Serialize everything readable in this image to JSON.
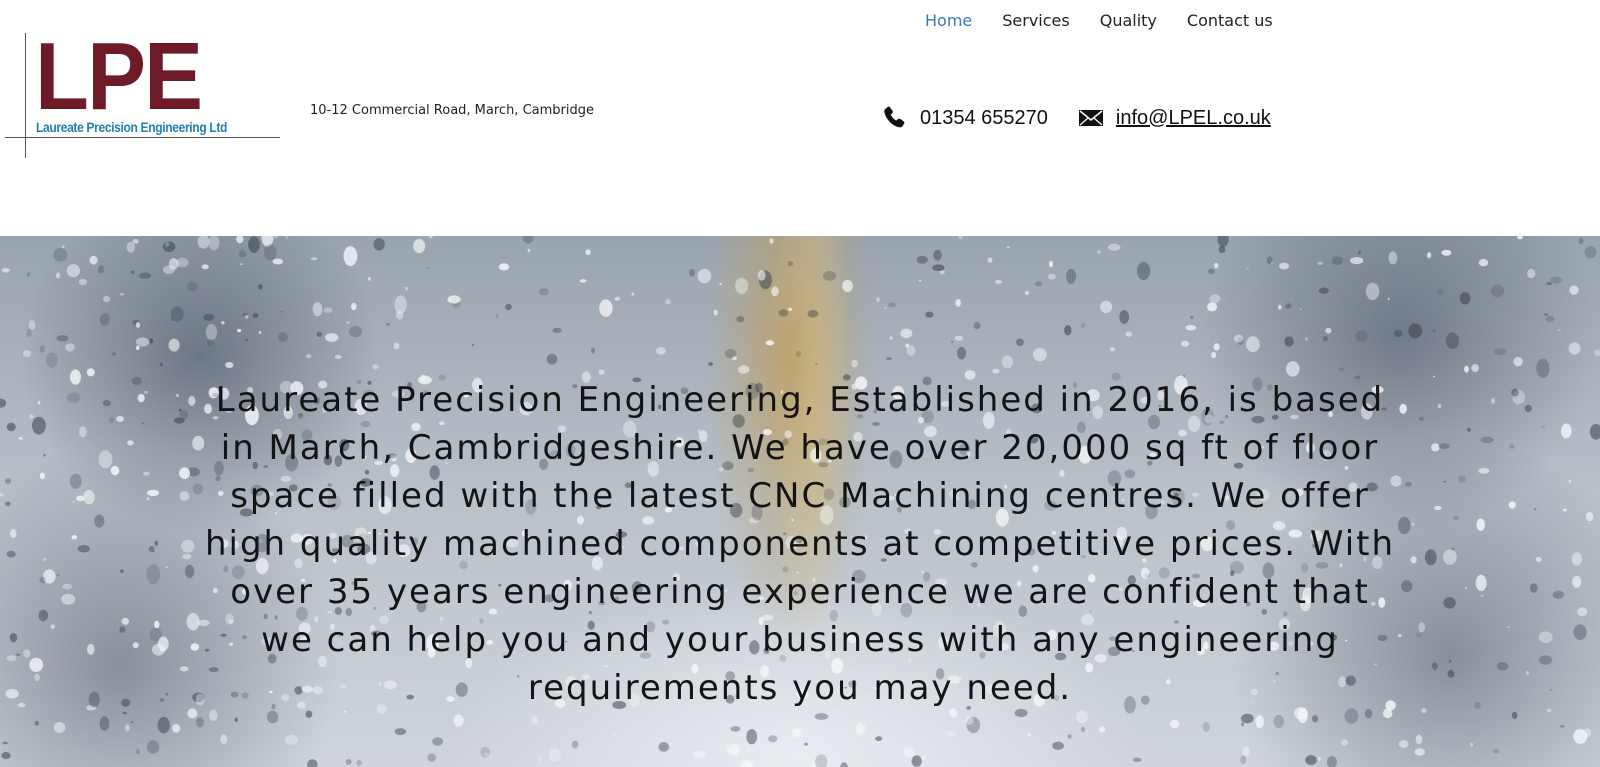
{
  "logo": {
    "letters": "LPE",
    "subtitle": "Laureate Precision Engineering Ltd",
    "colors": {
      "letters": "#6e1a27",
      "subtitle": "#1f7fb8"
    }
  },
  "address": "10-12 Commercial Road, March, Cambridge",
  "nav": {
    "items": [
      {
        "label": "Home",
        "active": true
      },
      {
        "label": "Services",
        "active": false
      },
      {
        "label": "Quality",
        "active": false
      },
      {
        "label": "Contact us",
        "active": false
      }
    ],
    "active_color": "#3b78b5"
  },
  "contact": {
    "phone_icon": "phone-icon",
    "phone": "01354 655270",
    "email_icon": "envelope-icon",
    "email": "info@LPEL.co.uk"
  },
  "hero": {
    "text": "Laureate Precision Engineering, Established in 2016, is based in March, Cambridgeshire. We have over 20,000 sq ft of floor space filled with the latest CNC Machining centres. We offer high quality machined components at competitive prices. With over 35 years engineering experience we are confident that we can help you and your business with any engineering requirements you may need."
  }
}
